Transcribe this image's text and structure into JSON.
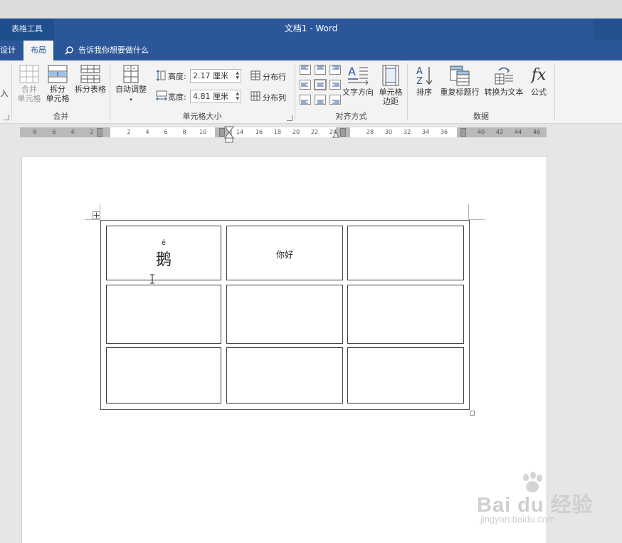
{
  "titlebar": {
    "context_label": "表格工具",
    "doc_title": "文档1  -  Word"
  },
  "tabs": {
    "design_label": "设计",
    "layout_label": "布局",
    "tell_me": "告诉我你想要做什么"
  },
  "ribbon": {
    "insert_partial": "入",
    "merge_group": {
      "label": "合并",
      "merge_cells": [
        "合并",
        "单元格"
      ],
      "split_cells": [
        "拆分",
        "单元格"
      ],
      "split_table": "拆分表格"
    },
    "cell_size_group": {
      "label": "单元格大小",
      "autofit": "自动调整",
      "height_label": "高度:",
      "height_value": "2.17 厘米",
      "width_label": "宽度:",
      "width_value": "4.81 厘米",
      "distribute_rows": "分布行",
      "distribute_cols": "分布列"
    },
    "alignment_group": {
      "label": "对齐方式",
      "text_direction": "文字方向",
      "cell_margins": [
        "单元格",
        "边距"
      ]
    },
    "data_group": {
      "label": "数据",
      "sort": "排序",
      "repeat_header": "重复标题行",
      "convert_to_text": "转换为文本",
      "formula": "公式",
      "formula_glyph": "fx"
    }
  },
  "ruler": {
    "left_ticks": [
      "8",
      "6",
      "4",
      "2"
    ],
    "middle_ticks": [
      "2",
      "4",
      "6",
      "8",
      "10"
    ],
    "right_ticks": [
      "14",
      "16",
      "18",
      "20",
      "22",
      "24"
    ],
    "far_ticks": [
      "28",
      "30",
      "32",
      "34",
      "36"
    ],
    "end_ticks": [
      "40",
      "42",
      "44",
      "46"
    ]
  },
  "table": {
    "cell_1_1_ruby": "é",
    "cell_1_1_char": "鹅",
    "cell_1_2_text": "你好"
  },
  "watermark": {
    "main": "Bai du 经验",
    "sub": "jingyan.baidu.com"
  },
  "colors": {
    "accent": "#2b579a",
    "ribbon_bg": "#f3f3f3",
    "page_bg": "#ffffff"
  }
}
